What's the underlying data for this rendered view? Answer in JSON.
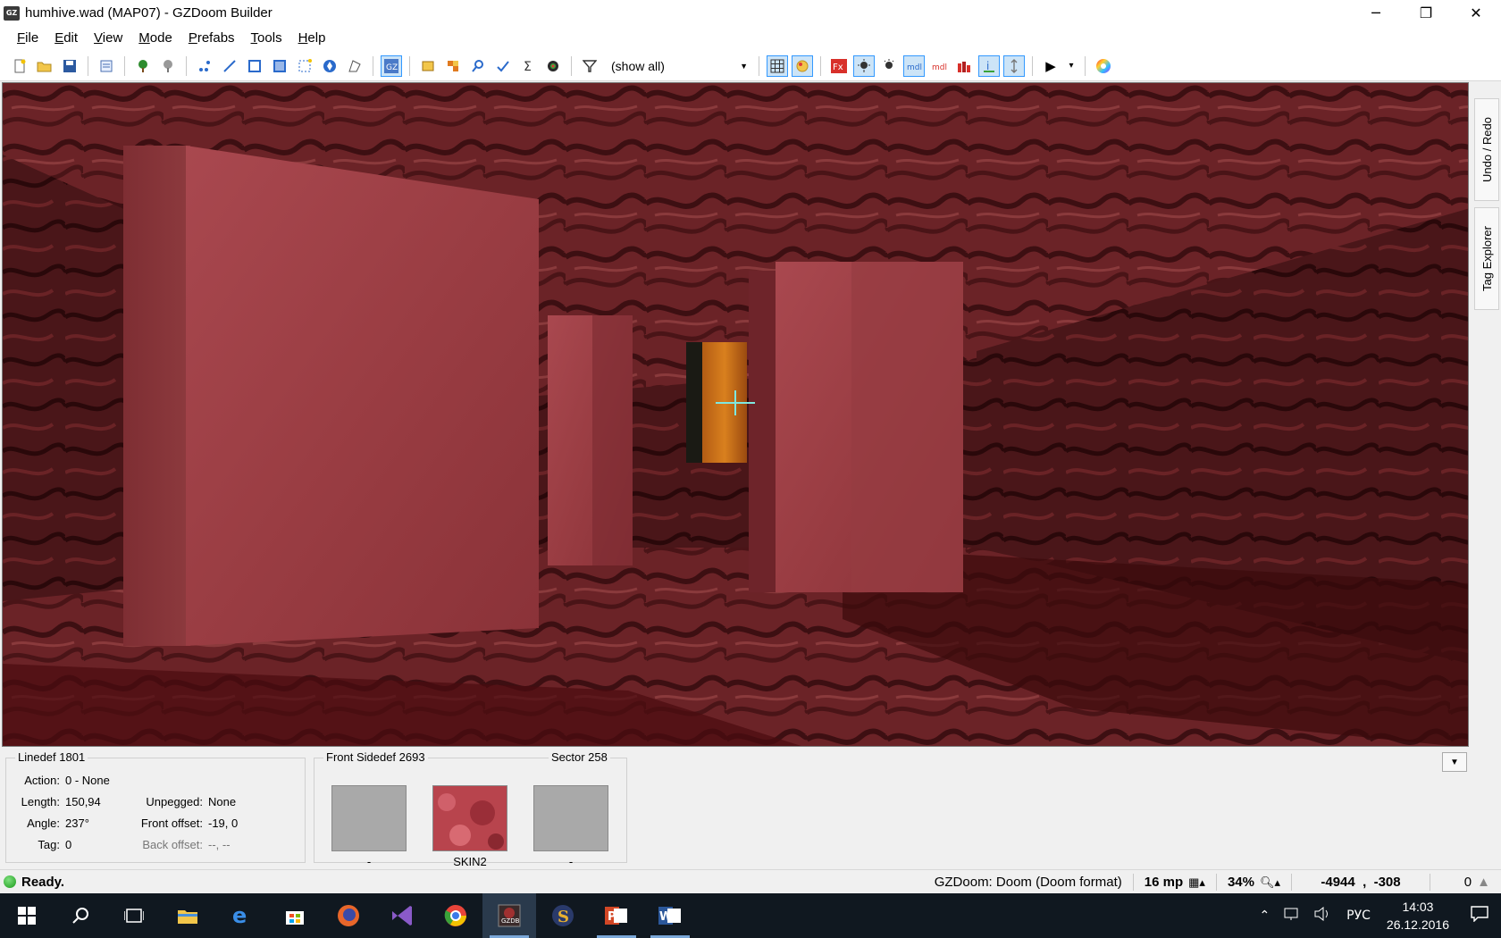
{
  "window": {
    "app_icon": "GZ",
    "title": "humhive.wad (MAP07) - GZDoom Builder",
    "minimize": "─",
    "restore": "❐",
    "close": "✕"
  },
  "menu": {
    "items": [
      {
        "underline": "F",
        "rest": "ile"
      },
      {
        "underline": "E",
        "rest": "dit"
      },
      {
        "underline": "V",
        "rest": "iew"
      },
      {
        "underline": "M",
        "rest": "ode"
      },
      {
        "underline": "P",
        "rest": "refabs"
      },
      {
        "underline": "T",
        "rest": "ools"
      },
      {
        "underline": "H",
        "rest": "elp"
      }
    ]
  },
  "toolbar": {
    "filter_value": "(show all)",
    "filter_arrow": "▼",
    "play": "▶",
    "play_arrow": "▾"
  },
  "dock": {
    "tab_undo_redo": "Undo / Redo",
    "tab_tag_explorer": "Tag Explorer"
  },
  "linedef": {
    "title": "Linedef 1801",
    "action_label": "Action:",
    "action_value": "0 - None",
    "length_label": "Length:",
    "length_value": "150,94",
    "angle_label": "Angle:",
    "angle_value": "237°",
    "tag_label": "Tag:",
    "tag_value": "0",
    "unpegged_label": "Unpegged:",
    "unpegged_value": "None",
    "front_offset_label": "Front offset:",
    "front_offset_value": "-19, 0",
    "back_offset_label": "Back offset:",
    "back_offset_value": "--, --"
  },
  "sidedef": {
    "title": "Front Sidedef 2693",
    "upper_label": "-",
    "middle_label": "SKIN2",
    "sector_title": "Sector 258",
    "sector_label": "-"
  },
  "status": {
    "text": "Ready.",
    "engine": "GZDoom: Doom (Doom format)",
    "grid": "16 mp",
    "zoom": "34%",
    "coords": "-4944  ,  -308",
    "count": "0"
  },
  "taskbar": {
    "lang": "РУС",
    "time": "14:03",
    "date": "26.12.2016"
  }
}
